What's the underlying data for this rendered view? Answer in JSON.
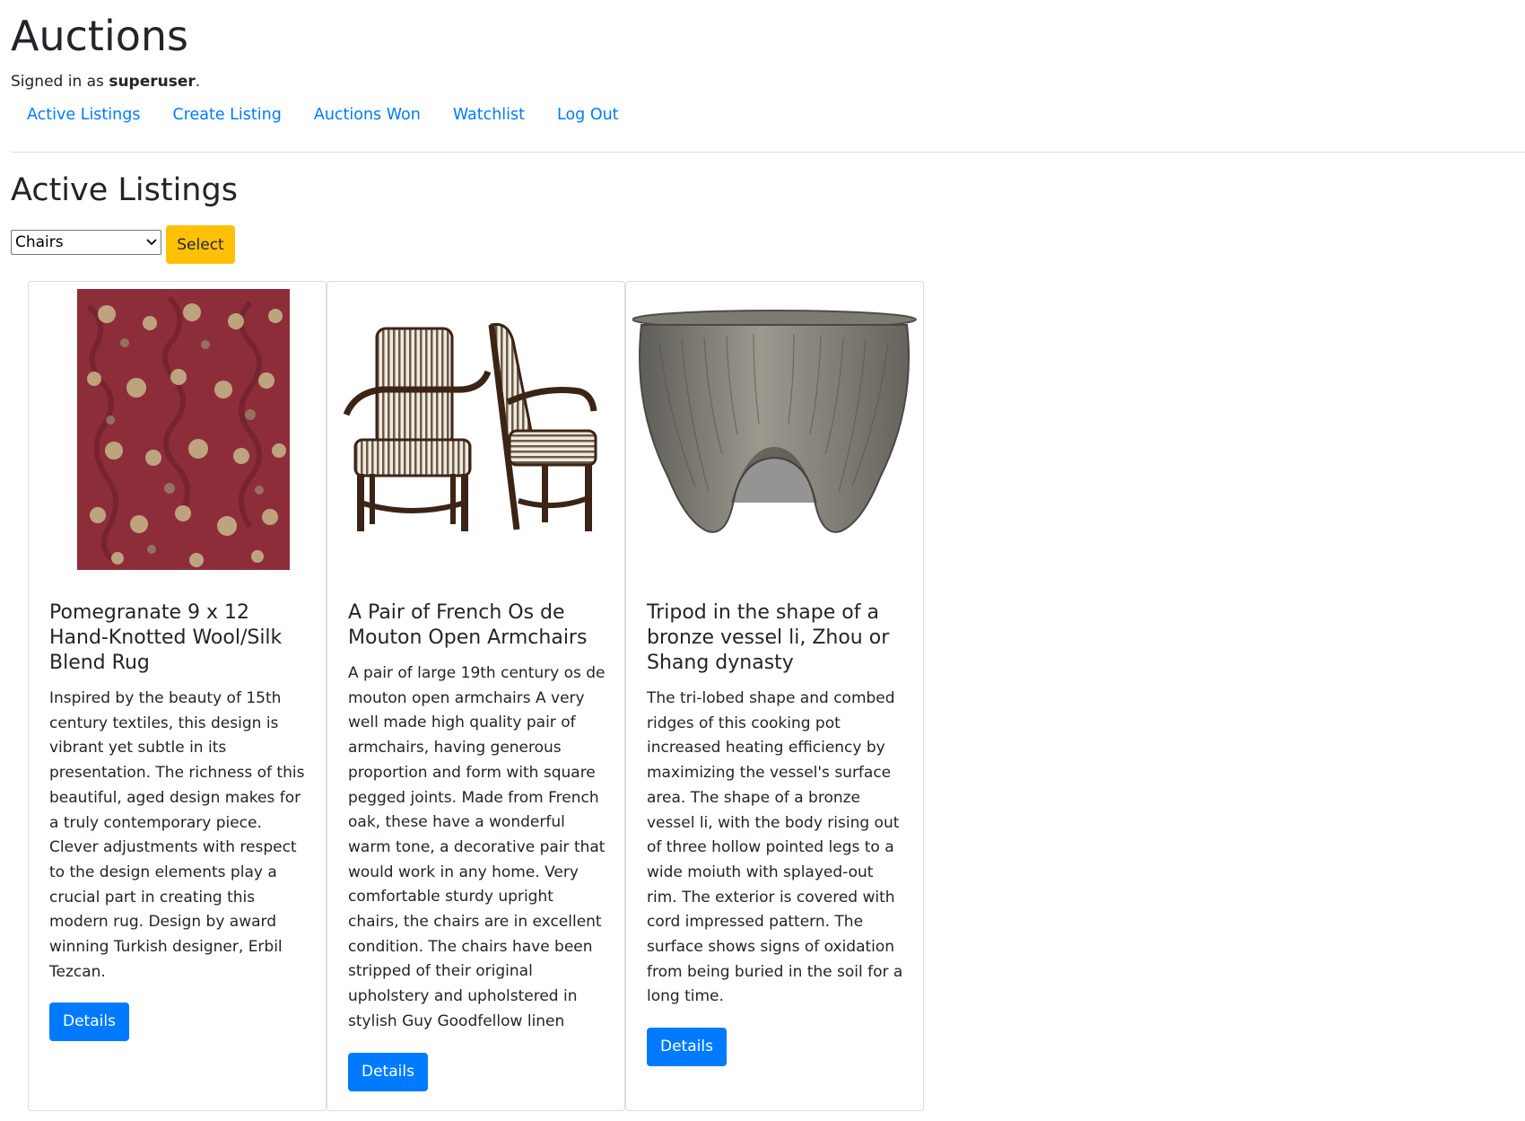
{
  "header": {
    "title": "Auctions",
    "signed_in_prefix": "Signed in as ",
    "username": "superuser",
    "signed_in_suffix": "."
  },
  "nav": {
    "items": [
      {
        "label": "Active Listings"
      },
      {
        "label": "Create Listing"
      },
      {
        "label": "Auctions Won"
      },
      {
        "label": "Watchlist"
      },
      {
        "label": "Log Out"
      }
    ]
  },
  "main": {
    "heading": "Active Listings",
    "category_filter": {
      "selected": "Chairs",
      "button_label": "Select"
    },
    "listings": [
      {
        "title": "Pomegranate 9 x 12 Hand-Knotted Wool/Silk Blend Rug",
        "description": "Inspired by the beauty of 15th century textiles, this design is vibrant yet subtle in its presentation. The richness of this beautiful, aged design makes for a truly contemporary piece. Clever adjustments with respect to the design elements play a crucial part in creating this modern rug. Design by award winning Turkish designer, Erbil Tezcan.",
        "button_label": "Details",
        "image": "rug-image"
      },
      {
        "title": "A Pair of French Os de Mouton Open Armchairs",
        "description": "A pair of large 19th century os de mouton open armchairs A very well made high quality pair of armchairs, having generous proportion and form with square pegged joints. Made from French oak, these have a wonderful warm tone, a decorative pair that would work in any home. Very comfortable sturdy upright chairs, the chairs are in excellent condition. The chairs have been stripped of their original upholstery and upholstered in stylish Guy Goodfellow linen",
        "button_label": "Details",
        "image": "armchairs-image"
      },
      {
        "title": "Tripod in the shape of a bronze vessel li, Zhou or Shang dynasty",
        "description": "The tri-lobed shape and combed ridges of this cooking pot increased heating efficiency by maximizing the vessel's surface area. The shape of a bronze vessel li, with the body rising out of three hollow pointed legs to a wide moiuth with splayed-out rim. The exterior is covered with cord impressed pattern. The surface shows signs of oxidation from being buried in the soil for a long time.",
        "button_label": "Details",
        "image": "tripod-vessel-image"
      }
    ]
  },
  "colors": {
    "link": "#007bff",
    "primary_button": "#007bff",
    "warning_button": "#ffc107",
    "text": "#212529"
  }
}
